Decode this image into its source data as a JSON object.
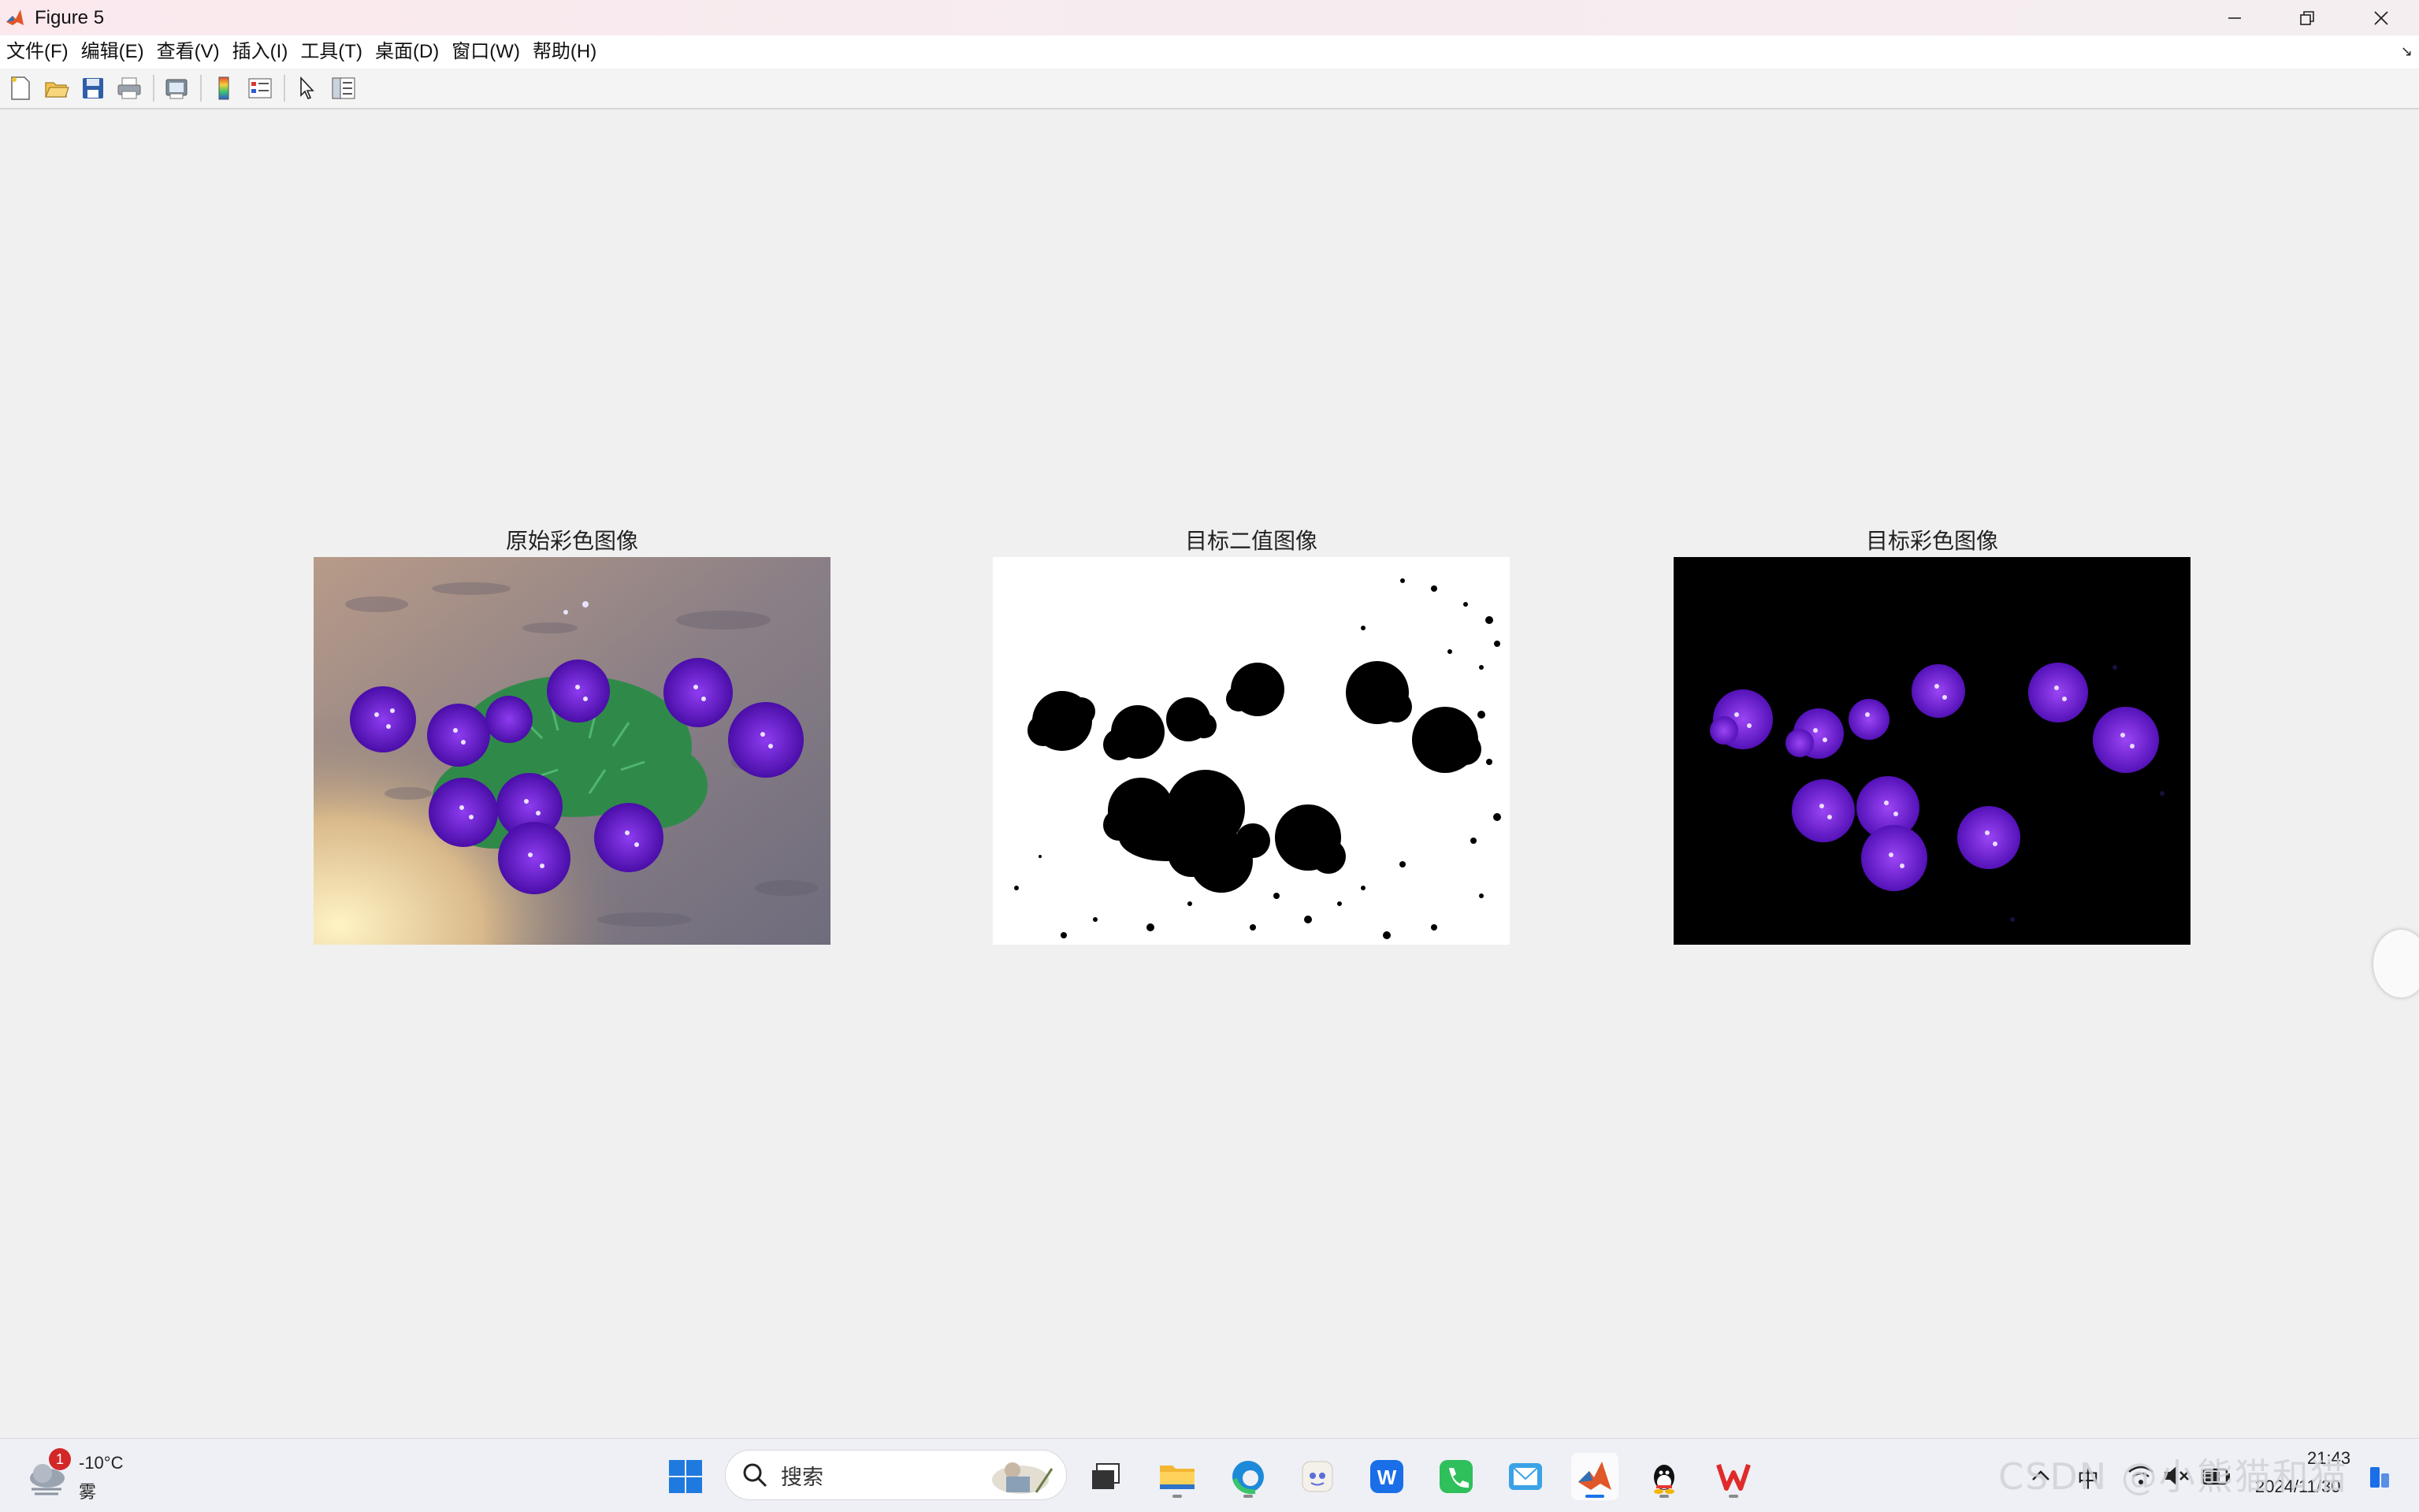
{
  "window": {
    "title": "Figure 5"
  },
  "menu": {
    "items": [
      "文件(F)",
      "编辑(E)",
      "查看(V)",
      "插入(I)",
      "工具(T)",
      "桌面(D)",
      "窗口(W)",
      "帮助(H)"
    ]
  },
  "toolbar": {
    "buttons": [
      "new-figure-icon",
      "open-folder-icon",
      "save-icon",
      "print-icon",
      "print-preview-icon",
      "colorbar-icon",
      "legend-icon",
      "pointer-icon",
      "property-editor-icon"
    ]
  },
  "figure": {
    "panels": [
      {
        "title": "原始彩色图像",
        "content": "original color photo of purple verbena flowers on soil"
      },
      {
        "title": "目标二值图像",
        "content": "binary mask, black flower regions on white background"
      },
      {
        "title": "目标彩色图像",
        "content": "purple flowers isolated on black background"
      }
    ]
  },
  "taskbar": {
    "weather": {
      "temp": "-10°C",
      "condition": "雾",
      "badge": "1"
    },
    "search_placeholder": "搜索",
    "apps": [
      "windows-start-icon",
      "search-icon",
      "task-view-icon",
      "file-explorer-icon",
      "edge-browser-icon",
      "assistant-app-icon",
      "writer-app-icon",
      "phone-link-icon",
      "mail-app-icon",
      "matlab-icon",
      "qq-icon",
      "wps-icon"
    ],
    "tray": {
      "ime": "中",
      "time": "21:43",
      "date": "2024/11/30",
      "watermark": "CSDN @小熊猫和猫"
    }
  },
  "colors": {
    "titlebar": "#f6ecef",
    "figure_bg": "#f0f0f0",
    "flower_purple": "#6a1fc9",
    "taskbar": "#eef0f5"
  }
}
